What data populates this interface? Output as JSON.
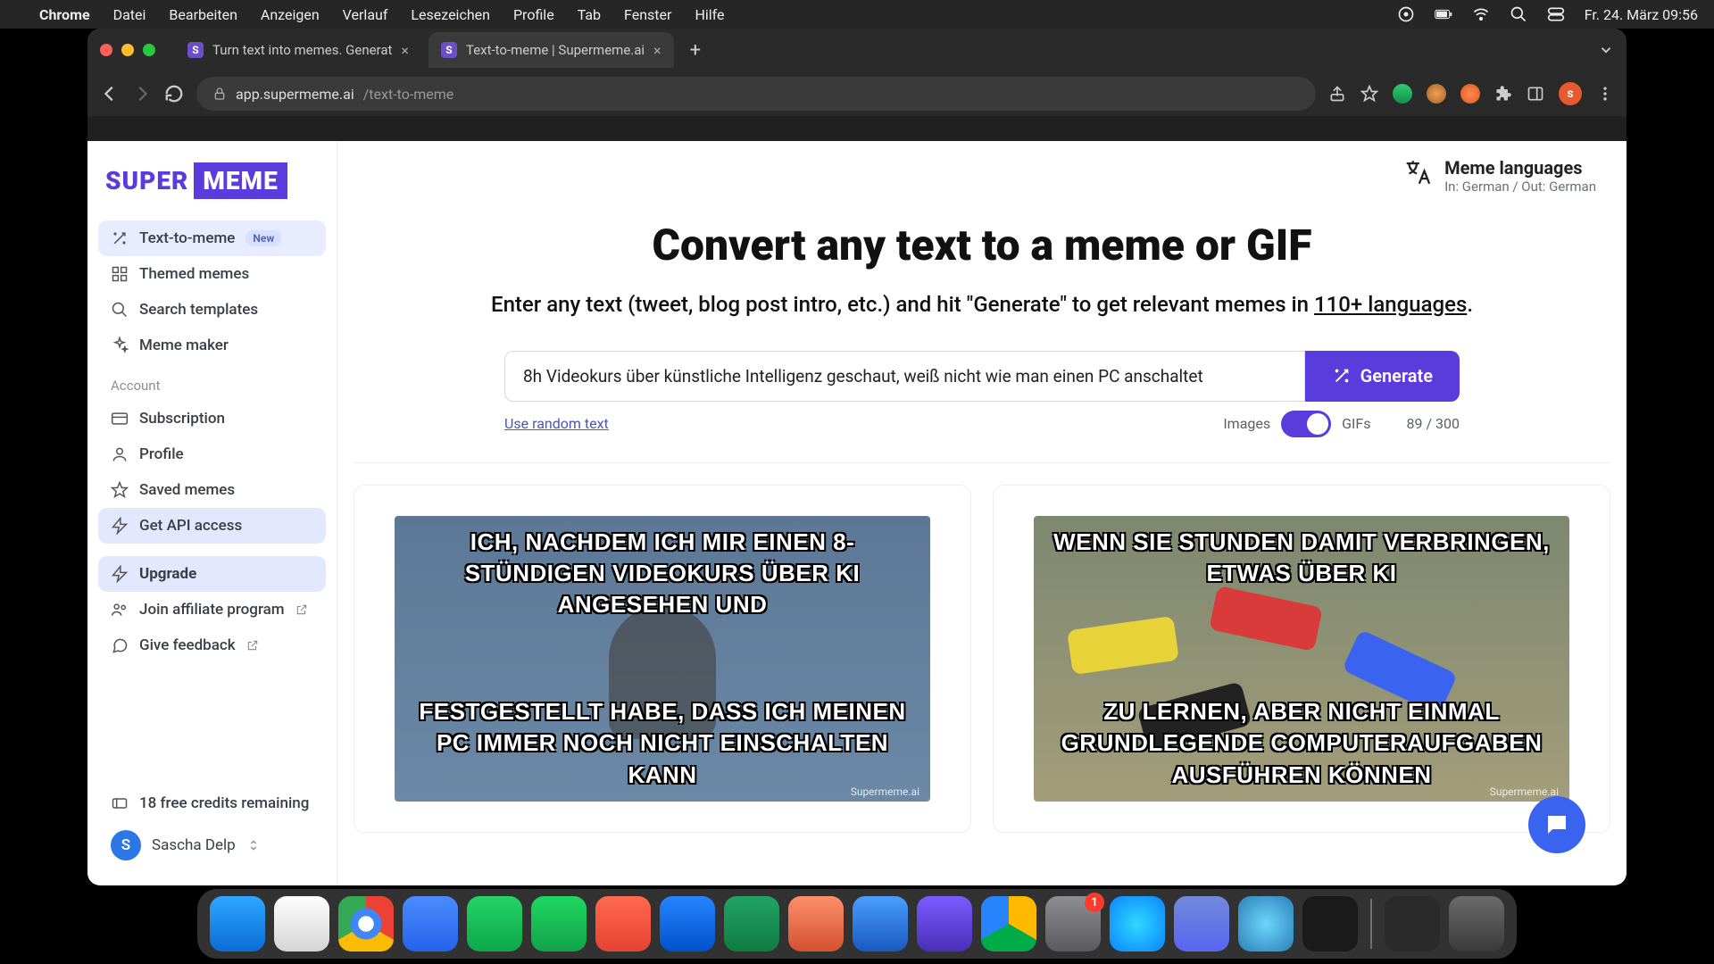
{
  "menubar": {
    "app": "Chrome",
    "items": [
      "Datei",
      "Bearbeiten",
      "Anzeigen",
      "Verlauf",
      "Lesezeichen",
      "Profile",
      "Tab",
      "Fenster",
      "Hilfe"
    ],
    "clock": "Fr. 24. März  09:56"
  },
  "browser": {
    "tabs": [
      {
        "favicon": "S",
        "title": "Turn text into memes. Generat"
      },
      {
        "favicon": "S",
        "title": "Text-to-meme | Supermeme.ai"
      }
    ],
    "active_tab": 1,
    "url_host": "app.supermeme.ai",
    "url_path": "/text-to-meme",
    "avatar_letter": "s"
  },
  "app": {
    "logo": {
      "a": "SUPER",
      "b": "MEME"
    },
    "sidebar": {
      "main": [
        {
          "icon": "wand",
          "label": "Text-to-meme",
          "badge": "New",
          "active": true
        },
        {
          "icon": "grid",
          "label": "Themed memes"
        },
        {
          "icon": "search",
          "label": "Search templates"
        },
        {
          "icon": "sparkle",
          "label": "Meme maker"
        }
      ],
      "account_header": "Account",
      "account": [
        {
          "icon": "card",
          "label": "Subscription"
        },
        {
          "icon": "user",
          "label": "Profile"
        },
        {
          "icon": "star",
          "label": "Saved memes"
        },
        {
          "icon": "bolt",
          "label": "Get API access",
          "variant": "api"
        }
      ],
      "upgrade": {
        "icon": "bolt",
        "label": "Upgrade"
      },
      "extra": [
        {
          "icon": "users",
          "label": "Join affiliate program",
          "ext": true
        },
        {
          "icon": "chat",
          "label": "Give feedback",
          "ext": true
        }
      ],
      "credits": {
        "icon": "ticket",
        "label": "18 free credits remaining"
      },
      "user": {
        "initial": "S",
        "name": "Sascha Delp"
      }
    },
    "lang": {
      "title": "Meme languages",
      "sub": "In: German / Out: German"
    },
    "hero": {
      "title": "Convert any text to a meme or GIF",
      "subtitle_a": "Enter any text (tweet, blog post intro, etc.) and hit \"Generate\" to get relevant memes in ",
      "subtitle_link": "110+ languages",
      "subtitle_b": "."
    },
    "input": {
      "value": "8h Videokurs über künstliche Intelligenz geschaut, weiß nicht wie man einen PC anschaltet",
      "generate": "Generate",
      "random": "Use random text",
      "mode_a": "Images",
      "mode_b": "GIFs",
      "count": "89 / 300"
    },
    "results": [
      {
        "top": "ICH, NACHDEM ICH MIR EINEN 8-STÜNDIGEN VIDEOKURS ÜBER KI ANGESEHEN UND",
        "bottom": "FESTGESTELLT HABE, DASS ICH MEINEN PC IMMER NOCH NICHT EINSCHALTEN KANN",
        "watermark": "Supermeme.ai"
      },
      {
        "top": "WENN SIE STUNDEN DAMIT VERBRINGEN, ETWAS ÜBER KI",
        "bottom": "ZU LERNEN, ABER NICHT EINMAL GRUNDLEGENDE COMPUTERAUFGABEN AUSFÜHREN KÖNNEN",
        "watermark": "Supermeme.ai"
      }
    ]
  },
  "dock": {
    "items": [
      {
        "name": "finder",
        "bg": "linear-gradient(#2fa8ff,#0a6cd6)"
      },
      {
        "name": "safari",
        "bg": "linear-gradient(#fefefe,#d4d4d4)"
      },
      {
        "name": "chrome",
        "bg": "radial-gradient(circle at 50% 50%,#fff 0 20%,#4285F4 20% 40%,transparent 40%),conic-gradient(#ea4335 0 120deg,#fbbc05 120deg 240deg,#34a853 240deg 360deg)"
      },
      {
        "name": "zoom",
        "bg": "linear-gradient(#4a8cff,#2563eb)"
      },
      {
        "name": "whatsapp",
        "bg": "linear-gradient(#25d366,#0da84a)"
      },
      {
        "name": "spotify",
        "bg": "linear-gradient(#1ed760,#13a34a)"
      },
      {
        "name": "todoist",
        "bg": "linear-gradient(#ff6a4d,#e44332)"
      },
      {
        "name": "trello",
        "bg": "linear-gradient(#2684ff,#0052cc)"
      },
      {
        "name": "excel",
        "bg": "linear-gradient(#21a366,#107c41)"
      },
      {
        "name": "powerpoint",
        "bg": "linear-gradient(#ff8f6b,#d35230)"
      },
      {
        "name": "word",
        "bg": "linear-gradient(#4a9eff,#185abd)"
      },
      {
        "name": "imovie",
        "bg": "linear-gradient(#7a5cff,#4a2fb8)"
      },
      {
        "name": "drive",
        "bg": "conic-gradient(#ffba00 0 120deg,#00ac47 120deg 240deg,#2684fc 240deg 360deg)"
      },
      {
        "name": "settings",
        "bg": "linear-gradient(#8e8e93,#5a5a5e)",
        "badge": "1"
      },
      {
        "name": "siri",
        "bg": "radial-gradient(circle,#2fd8ff,#0a84ff)"
      },
      {
        "name": "discord",
        "bg": "linear-gradient(#7289da,#5865f2)"
      },
      {
        "name": "quicktime",
        "bg": "radial-gradient(circle,#6dd5fa,#2980b9)"
      },
      {
        "name": "voice",
        "bg": "#1a1a1a"
      },
      {
        "name": "divider"
      },
      {
        "name": "mission",
        "bg": "#2a2a2a"
      },
      {
        "name": "trash",
        "bg": "linear-gradient(#6b6b6b,#3a3a3a)"
      }
    ]
  }
}
